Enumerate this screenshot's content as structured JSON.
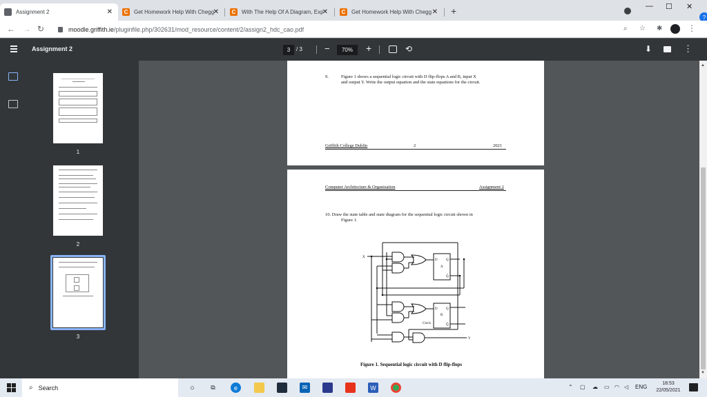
{
  "tabs": [
    {
      "title": "Assignment 2",
      "icon": "moodle-icon",
      "active": true
    },
    {
      "title": "Get Homework Help With Chegg",
      "icon": "chegg-icon",
      "active": false
    },
    {
      "title": "With The Help Of A Diagram, Exp",
      "icon": "chegg-icon",
      "active": false
    },
    {
      "title": "Get Homework Help With Chegg",
      "icon": "chegg-icon",
      "active": false
    }
  ],
  "address": {
    "domain": "moodle.griffith.ie",
    "path": "/pluginfile.php/302631/mod_resource/content/2/assign2_hdc_cao.pdf"
  },
  "pdf_toolbar": {
    "title": "Assignment 2",
    "page_current": "3",
    "page_total": "/ 3",
    "zoom": "70%"
  },
  "thumbnails": [
    {
      "label": "1"
    },
    {
      "label": "2"
    },
    {
      "label": "3",
      "selected": true
    }
  ],
  "page2": {
    "question_num": "9.",
    "question_text_1": "Figure 1 shows a sequential logic circuit with D flip-flops A and B, input X",
    "question_text_2": "and output Y. Write the output equation and the state equations for the circuit.",
    "footer_left": "Griffith College Dublin",
    "footer_center": "2",
    "footer_right": "2021"
  },
  "page3": {
    "header_left": "Computer Architecture & Organisation",
    "header_right": "Assignment 2",
    "question_text_1": "10. Draw the state table and state diagram for the sequential logic circuit shown in",
    "question_text_2": "Figure 1.",
    "circuit": {
      "input_label": "X",
      "output_label": "Y",
      "clock_label": "Clock",
      "ff_a": {
        "d": "D",
        "q": "Q",
        "name": "A",
        "qbar": "Q̄"
      },
      "ff_b": {
        "d": "D",
        "q": "Q",
        "name": "B",
        "qbar": "Q̄"
      }
    },
    "caption": "Figure 1. Sequential logic circuit with D flip-flops"
  },
  "taskbar": {
    "search_placeholder": "Search",
    "language": "ENG",
    "time": "18:53",
    "date": "22/05/2021"
  },
  "colors": {
    "pdf_toolbar": "#323639",
    "viewer_bg": "#525659",
    "selection": "#8ab4f8",
    "chegg": "#eb7100"
  }
}
